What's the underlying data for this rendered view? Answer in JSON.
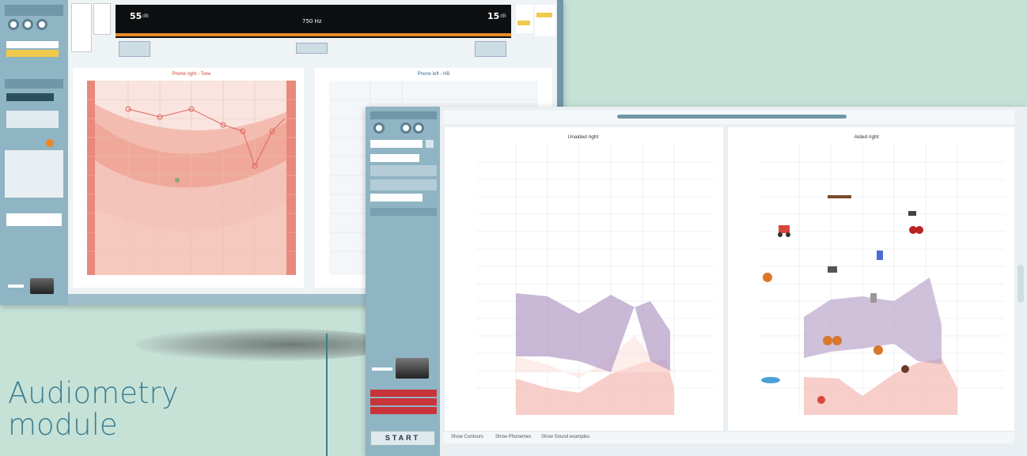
{
  "headline": {
    "line1": "Audiometry",
    "line2": "module"
  },
  "back_window": {
    "stimulus_left": {
      "level": "55",
      "unit": "dB"
    },
    "frequency": "750 Hz",
    "stimulus_right": {
      "level": "15",
      "unit": "dB"
    },
    "chart_right_ear": {
      "title": "Phone right - Tone"
    },
    "chart_left_ear": {
      "title": "Phone left - HB"
    }
  },
  "front_window": {
    "side_buttons": [
      "",
      "",
      ""
    ],
    "start_label": "START",
    "chart_unaided": {
      "title": "Unaided right"
    },
    "chart_aided": {
      "title": "Aided right"
    },
    "bottom_checks": [
      "Show Contours",
      "Show Phonemes",
      "Show Sound examples"
    ]
  },
  "colors": {
    "background": "#c6e2d7",
    "accent_red": "#d8473c",
    "speech_banana": "#b7a0c8",
    "sidebar": "#8fb4c3"
  }
}
